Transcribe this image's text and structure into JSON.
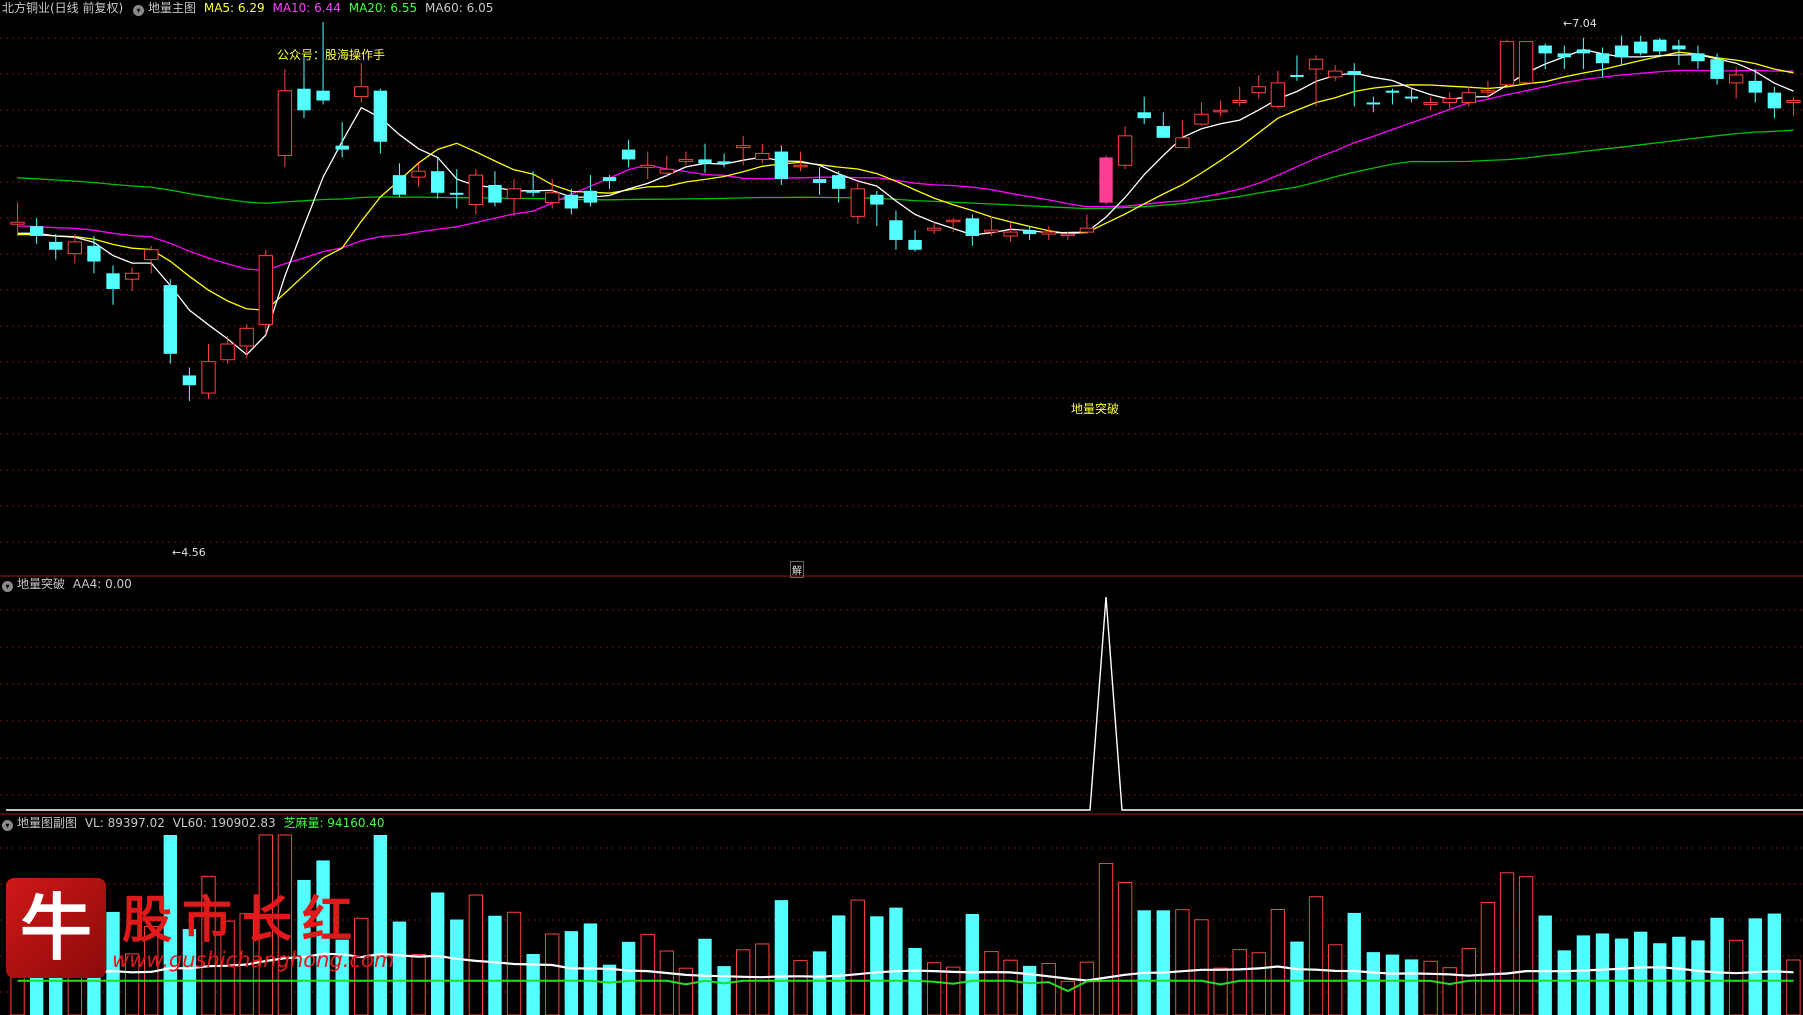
{
  "main_panel": {
    "stock_name": "北方铜业(日线 前复权)",
    "chart_name": "地量主图",
    "ma5_label": "MA5: 6.29",
    "ma10_label": "MA10: 6.44",
    "ma20_label": "MA20: 6.55",
    "ma60_label": "MA60: 6.05",
    "wechat_note": "公众号：股海操作手",
    "high_label": "7.04",
    "low_label": "4.56",
    "signal_label": "地量突破",
    "unlock_icon_text": "解"
  },
  "signal_panel": {
    "title": "地量突破",
    "aa4_label": "AA4: 0.00"
  },
  "volume_panel": {
    "title": "地量图副图",
    "vl_label": "VL: 89397.02",
    "vl60_label": "VL60: 190902.83",
    "dl_label": "芝麻量: 94160.40"
  },
  "watermark": {
    "icon_char": "牛",
    "title": "股市长红",
    "url": "www.gushichanghong.com"
  },
  "colors": {
    "up": "#ff4040",
    "down": "#54ffff",
    "ma5": "#ffffff",
    "ma10": "#ffff00",
    "ma20": "#ff00ff",
    "ma60": "#00c000",
    "signal_bar": "#ff3c96",
    "separator": "#a01818",
    "grid": "#7a1010"
  },
  "chart_data": {
    "type": "candlestick",
    "price_range": [
      4.4,
      7.15
    ],
    "signal_index": 57,
    "candles": [
      [
        6.11,
        6.12,
        6.22,
        6.05
      ],
      [
        6.1,
        6.05,
        6.14,
        6.01
      ],
      [
        6.02,
        5.98,
        6.06,
        5.93
      ],
      [
        5.96,
        6.02,
        6.06,
        5.91
      ],
      [
        6.0,
        5.92,
        6.05,
        5.86
      ],
      [
        5.86,
        5.78,
        5.9,
        5.7
      ],
      [
        5.83,
        5.86,
        5.89,
        5.77
      ],
      [
        5.93,
        5.98,
        6.0,
        5.86
      ],
      [
        5.8,
        5.45,
        5.83,
        5.4
      ],
      [
        5.34,
        5.29,
        5.38,
        5.21
      ],
      [
        5.25,
        5.41,
        5.5,
        5.22
      ],
      [
        5.42,
        5.5,
        5.54,
        5.4
      ],
      [
        5.49,
        5.58,
        5.6,
        5.43
      ],
      [
        5.6,
        5.95,
        5.98,
        5.55
      ],
      [
        6.46,
        6.79,
        6.9,
        6.4
      ],
      [
        6.8,
        6.69,
        6.97,
        6.65
      ],
      [
        6.79,
        6.74,
        7.14,
        6.72
      ],
      [
        6.51,
        6.49,
        6.63,
        6.45
      ],
      [
        6.76,
        6.81,
        6.93,
        6.73
      ],
      [
        6.79,
        6.53,
        6.8,
        6.47
      ],
      [
        6.36,
        6.26,
        6.42,
        6.25
      ],
      [
        6.35,
        6.38,
        6.42,
        6.3
      ],
      [
        6.38,
        6.27,
        6.45,
        6.24
      ],
      [
        6.27,
        6.26,
        6.39,
        6.19
      ],
      [
        6.21,
        6.36,
        6.39,
        6.16
      ],
      [
        6.31,
        6.22,
        6.38,
        6.2
      ],
      [
        6.24,
        6.29,
        6.34,
        6.15
      ],
      [
        6.28,
        6.27,
        6.38,
        6.25
      ],
      [
        6.22,
        6.27,
        6.34,
        6.19
      ],
      [
        6.26,
        6.19,
        6.29,
        6.16
      ],
      [
        6.28,
        6.22,
        6.36,
        6.2
      ],
      [
        6.35,
        6.33,
        6.36,
        6.29
      ],
      [
        6.49,
        6.44,
        6.54,
        6.4
      ],
      [
        6.4,
        6.41,
        6.48,
        6.34
      ],
      [
        6.37,
        6.39,
        6.46,
        6.35
      ],
      [
        6.43,
        6.44,
        6.48,
        6.41
      ],
      [
        6.44,
        6.42,
        6.52,
        6.37
      ],
      [
        6.43,
        6.42,
        6.47,
        6.4
      ],
      [
        6.5,
        6.51,
        6.56,
        6.41
      ],
      [
        6.44,
        6.47,
        6.52,
        6.42
      ],
      [
        6.48,
        6.34,
        6.51,
        6.31
      ],
      [
        6.41,
        6.41,
        6.48,
        6.38
      ],
      [
        6.34,
        6.32,
        6.4,
        6.26
      ],
      [
        6.36,
        6.29,
        6.38,
        6.22
      ],
      [
        6.15,
        6.29,
        6.32,
        6.11
      ],
      [
        6.26,
        6.21,
        6.28,
        6.1
      ],
      [
        6.13,
        6.03,
        6.18,
        5.98
      ],
      [
        6.03,
        5.98,
        6.08,
        5.97
      ],
      [
        6.08,
        6.09,
        6.12,
        6.06
      ],
      [
        6.13,
        6.13,
        6.14,
        6.07
      ],
      [
        6.14,
        6.05,
        6.16,
        6.0
      ],
      [
        6.07,
        6.08,
        6.15,
        6.05
      ],
      [
        6.05,
        6.07,
        6.12,
        6.02
      ],
      [
        6.08,
        6.06,
        6.1,
        6.03
      ],
      [
        6.06,
        6.07,
        6.1,
        6.03
      ],
      [
        6.06,
        6.06,
        6.07,
        6.03
      ],
      [
        6.07,
        6.09,
        6.16,
        6.06
      ],
      [
        6.22,
        6.45,
        6.46,
        6.21
      ],
      [
        6.41,
        6.56,
        6.61,
        6.39
      ],
      [
        6.68,
        6.65,
        6.76,
        6.62
      ],
      [
        6.61,
        6.55,
        6.68,
        6.55
      ],
      [
        6.5,
        6.55,
        6.64,
        6.5
      ],
      [
        6.62,
        6.67,
        6.73,
        6.61
      ],
      [
        6.69,
        6.69,
        6.74,
        6.66
      ],
      [
        6.73,
        6.74,
        6.81,
        6.71
      ],
      [
        6.78,
        6.81,
        6.87,
        6.75
      ],
      [
        6.71,
        6.83,
        6.89,
        6.7
      ],
      [
        6.87,
        6.86,
        6.97,
        6.84
      ],
      [
        6.9,
        6.95,
        6.97,
        6.71
      ],
      [
        6.86,
        6.89,
        6.92,
        6.84
      ],
      [
        6.89,
        6.87,
        6.93,
        6.71
      ],
      [
        6.73,
        6.72,
        6.76,
        6.68
      ],
      [
        6.79,
        6.78,
        6.8,
        6.72
      ],
      [
        6.76,
        6.75,
        6.8,
        6.73
      ],
      [
        6.72,
        6.73,
        6.76,
        6.69
      ],
      [
        6.73,
        6.75,
        6.78,
        6.7
      ],
      [
        6.73,
        6.78,
        6.81,
        6.71
      ],
      [
        6.79,
        6.79,
        6.84,
        6.75
      ],
      [
        6.82,
        7.04,
        7.05,
        6.85
      ],
      [
        6.83,
        7.04,
        7.04,
        6.85
      ],
      [
        7.02,
        6.98,
        7.03,
        6.9
      ],
      [
        6.98,
        6.96,
        7.02,
        6.9
      ],
      [
        7.0,
        6.98,
        7.06,
        6.9
      ],
      [
        6.98,
        6.93,
        7.01,
        6.86
      ],
      [
        7.02,
        6.96,
        7.07,
        6.92
      ],
      [
        7.04,
        6.98,
        7.07,
        6.97
      ],
      [
        7.05,
        6.99,
        7.06,
        6.96
      ],
      [
        7.02,
        7.0,
        7.05,
        6.92
      ],
      [
        6.98,
        6.94,
        7.02,
        6.9
      ],
      [
        6.95,
        6.85,
        6.98,
        6.82
      ],
      [
        6.83,
        6.87,
        6.91,
        6.75
      ],
      [
        6.84,
        6.78,
        6.9,
        6.73
      ],
      [
        6.78,
        6.7,
        6.81,
        6.65
      ],
      [
        6.73,
        6.74,
        6.76,
        6.66
      ]
    ]
  }
}
